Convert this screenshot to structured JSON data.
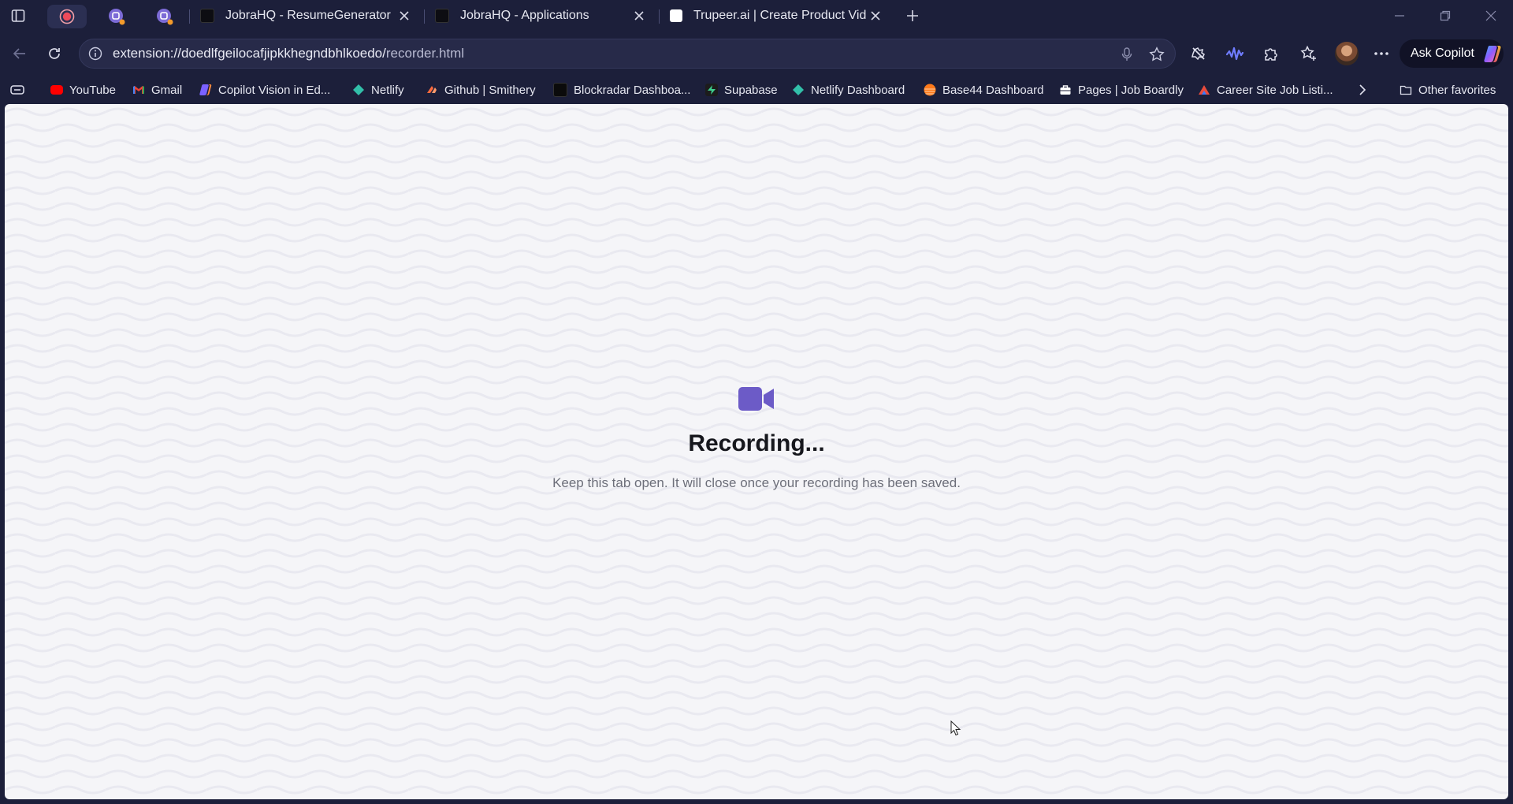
{
  "tabs": [
    {
      "title": "JobraHQ - ResumeGenerator",
      "favicon": "jobra-icon"
    },
    {
      "title": "JobraHQ - Applications",
      "favicon": "jobra-icon"
    },
    {
      "title": "Trupeer.ai | Create Product Videos",
      "favicon": "trupeer-icon"
    }
  ],
  "address_bar": {
    "url_host": "extension://doedlfgeilocafjipkkhegndbhlkoedo/",
    "url_path": "recorder.html"
  },
  "copilot": {
    "label": "Ask Copilot"
  },
  "favorites": [
    {
      "label": "YouTube",
      "icon": "youtube-icon",
      "color": "#ff0000"
    },
    {
      "label": "Gmail",
      "icon": "gmail-icon",
      "color": "#ea4335"
    },
    {
      "label": "Copilot Vision in Ed...",
      "icon": "copilot-icon",
      "color": "#7b61ff"
    },
    {
      "label": "Netlify",
      "icon": "netlify-icon",
      "color": "#32bfa9"
    },
    {
      "label": "Github | Smithery",
      "icon": "smithery-icon",
      "color": "#ff6a3d"
    },
    {
      "label": "Blockradar Dashboa...",
      "icon": "blockradar-icon",
      "color": "#c6ff00"
    },
    {
      "label": "Supabase",
      "icon": "supabase-icon",
      "color": "#3ecf8e"
    },
    {
      "label": "Netlify Dashboard",
      "icon": "netlify-icon",
      "color": "#32bfa9"
    },
    {
      "label": "Base44 Dashboard",
      "icon": "base44-icon",
      "color": "#ff7a1a"
    },
    {
      "label": "Pages | Job Boardly",
      "icon": "briefcase-icon",
      "color": "#ffffff"
    },
    {
      "label": "Career Site Job Listi...",
      "icon": "career-site-icon",
      "color": "#e94b3c"
    }
  ],
  "other_favorites": {
    "label": "Other favorites"
  },
  "recorder": {
    "title": "Recording...",
    "subtitle": "Keep this tab open. It will close once your recording has been saved.",
    "icon": "video-camera-icon",
    "accent": "#6c5bc7"
  }
}
